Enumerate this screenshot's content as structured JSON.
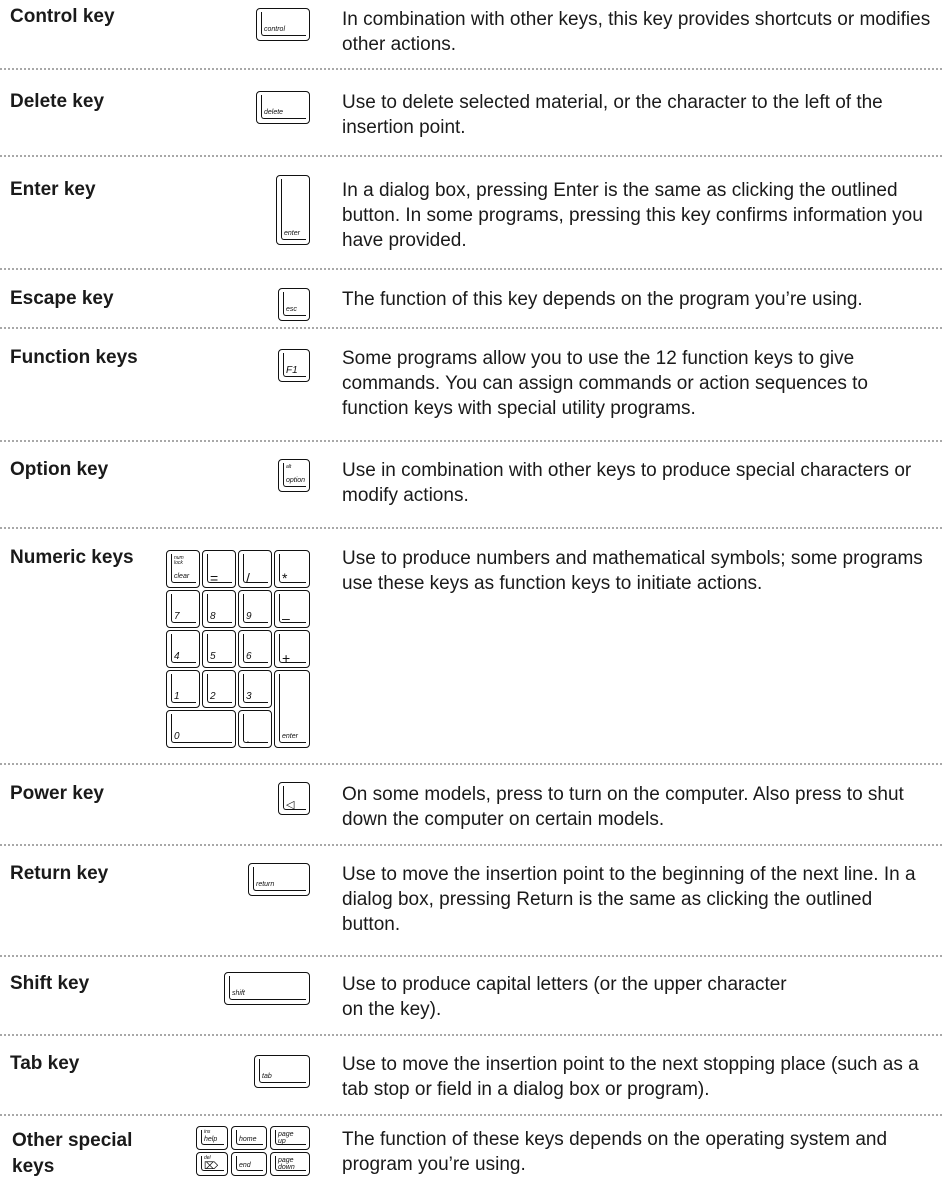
{
  "entries": [
    {
      "term": "Control key",
      "desc": "In combination with other keys, this key provides shortcuts or modifies other actions.",
      "key_label": "control"
    },
    {
      "term": "Delete key",
      "desc": "Use to delete selected material, or the character to the left of the insertion point.",
      "key_label": "delete"
    },
    {
      "term": "Enter key",
      "desc": "In a dialog box, pressing Enter is the same as clicking the outlined button. In some programs, pressing this key confirms information you have provided.",
      "key_label": "enter"
    },
    {
      "term": "Escape key",
      "desc": "The function of this key depends on the program you’re using.",
      "key_label": "esc"
    },
    {
      "term": "Function keys",
      "desc": "Some programs allow you to use the 12 function keys to give commands. You can assign commands or action sequences to function keys with special utility programs.",
      "key_label": "F1"
    },
    {
      "term": "Option key",
      "desc": "Use in combination with other keys to produce special characters or modify actions.",
      "key_label": "option",
      "key_sublabel": "alt"
    },
    {
      "term": "Numeric keys",
      "desc": "Use to produce numbers and mathematical symbols; some programs use these keys as function keys to initiate actions.",
      "keypad": {
        "numlock_sub": "num lock",
        "clear": "clear",
        "eq": "=",
        "slash": "/",
        "star": "*",
        "k7": "7",
        "k8": "8",
        "k9": "9",
        "minus": "–",
        "k4": "4",
        "k5": "5",
        "k6": "6",
        "plus": "+",
        "k1": "1",
        "k2": "2",
        "k3": "3",
        "k0": "0",
        "dot": ".",
        "enter": "enter"
      }
    },
    {
      "term": "Power key",
      "desc": "On some models, press to turn on the computer. Also press to shut down the computer on certain models.",
      "key_label": "◁"
    },
    {
      "term": "Return key",
      "desc": "Use to move the insertion point to the beginning of the next line. In a dialog box, pressing Return is the same as clicking the outlined button.",
      "key_label": "return"
    },
    {
      "term": "Shift key",
      "desc": "Use to produce capital letters (or the upper character on the key).",
      "key_label": "shift"
    },
    {
      "term": "Tab key",
      "desc": "Use to move the insertion point to the next stopping place (such as a tab stop or field in a dialog box or program).",
      "key_label": "tab"
    },
    {
      "term": "Other special\nkeys",
      "desc": "The function of these keys depends on the operating system and program you’re using.",
      "special": {
        "help_sub": "ins",
        "help": "help",
        "home": "home",
        "pageup": "page up",
        "del_sub": "del",
        "del": "⌦",
        "end": "end",
        "pagedown": "page down"
      }
    }
  ]
}
